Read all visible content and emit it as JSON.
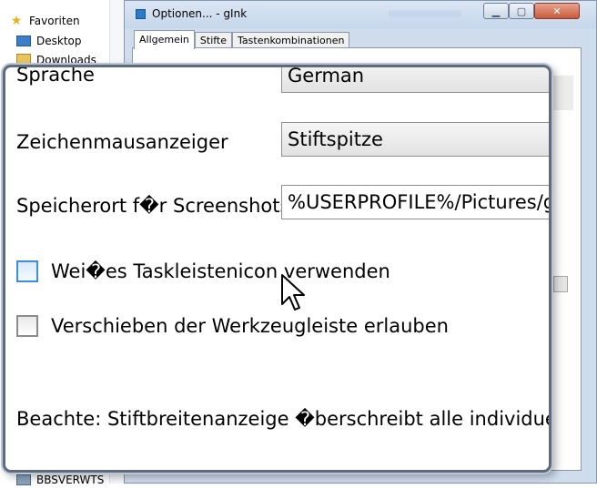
{
  "explorer": {
    "favorites": "Favoriten",
    "desktop": "Desktop",
    "downloads": "Downloads",
    "bottom_item": "BBSVERWTS"
  },
  "window": {
    "title": "Optionen... - gInk",
    "tabs": [
      "Allgemein",
      "Stifte",
      "Tastenkombinationen"
    ],
    "active_tab": "Allgemein"
  },
  "zoom": {
    "language_label": "Sprache",
    "language_value": "German",
    "cursor_label": "Zeichenmausanzeiger",
    "cursor_value": "Stiftspitze",
    "screenshot_path_label": "Speicherort f�r Screenshots",
    "screenshot_path_value": "%USERPROFILE%/Pictures/g",
    "white_tray_icon_label": "Wei�es Taskleistenicon verwenden",
    "white_tray_icon_checked": false,
    "allow_toolbar_move_label": "Verschieben der Werkzeugleiste erlauben",
    "allow_toolbar_move_checked": false,
    "note": "Beachte: Stiftbreitenanzeige �berschreibt alle individuellen Stif"
  },
  "colors": {
    "window_frame": "#cfdcec",
    "checkbox_hover": "#3c8ee0",
    "overlay_border": "#5f6b7a"
  }
}
